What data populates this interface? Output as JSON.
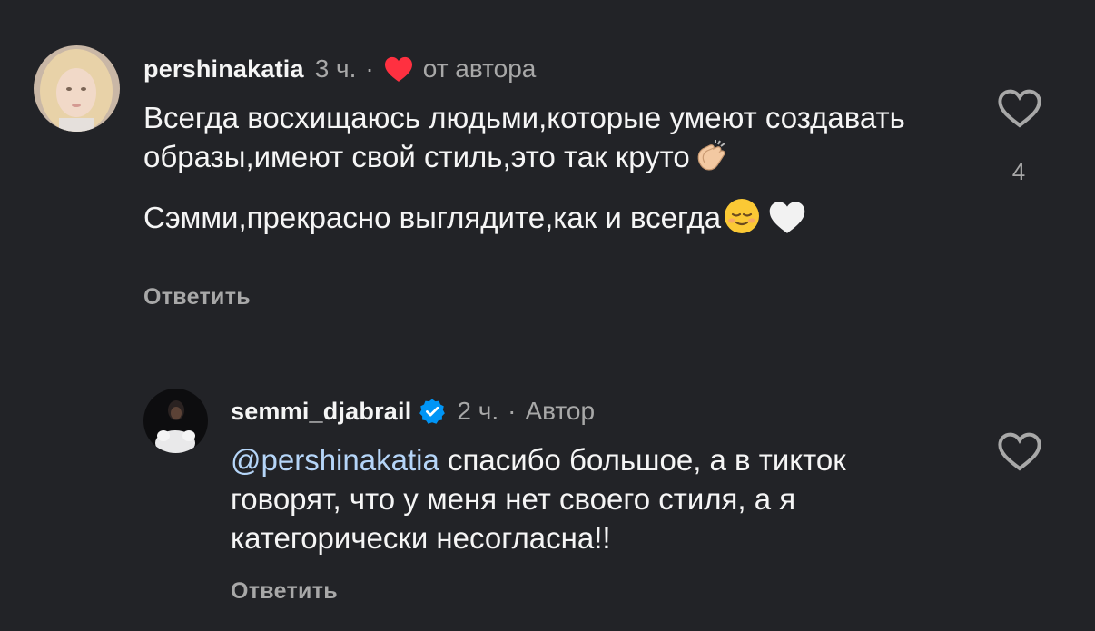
{
  "comments": [
    {
      "username": "pershinakatia",
      "time": "3 ч.",
      "separator": "·",
      "author_liked_label": "от автора",
      "text_paragraphs": [
        "Всегда восхищаюсь людьми,которые умеют создавать образы,имеют свой стиль,это так круто",
        "Сэмми,прекрасно выглядите,как и всегда"
      ],
      "emojis": [
        "clapping-hands-emoji",
        "relieved-face-emoji",
        "white-heart-emoji"
      ],
      "reply_label": "Ответить",
      "like_count": "4"
    },
    {
      "username": "semmi_djabrail",
      "verified": true,
      "time": "2 ч.",
      "separator": "·",
      "author_label": "Автор",
      "mention": "@pershinakatia",
      "text": " спасибо большое, а в тикток говорят, что у меня нет своего стиля, а я категорически несогласна!!",
      "reply_label": "Ответить"
    }
  ],
  "colors": {
    "background": "#222327",
    "primary_text": "#f5f5f5",
    "secondary_text": "#a8a8a8",
    "mention": "#b5d5f8",
    "heart": "#ff3040",
    "verified": "#0095f6"
  }
}
